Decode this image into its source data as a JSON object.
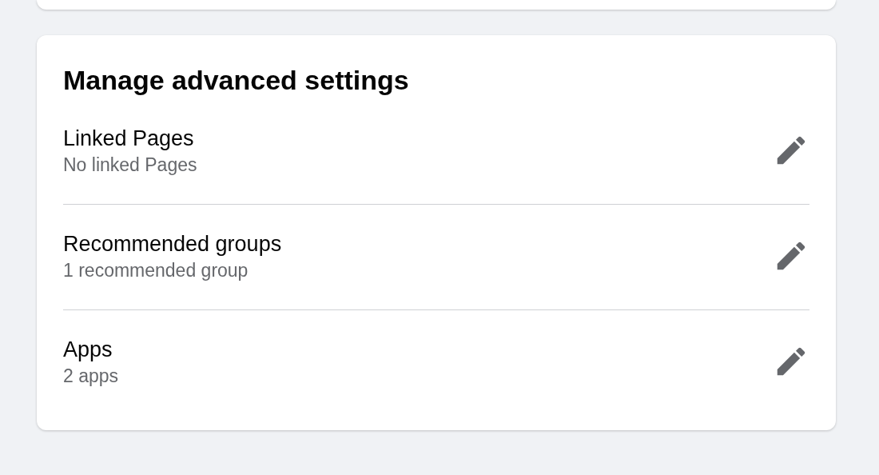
{
  "section": {
    "title": "Manage advanced settings",
    "rows": [
      {
        "label": "Linked Pages",
        "detail": "No linked Pages"
      },
      {
        "label": "Recommended groups",
        "detail": "1 recommended group"
      },
      {
        "label": "Apps",
        "detail": "2 apps"
      }
    ]
  }
}
